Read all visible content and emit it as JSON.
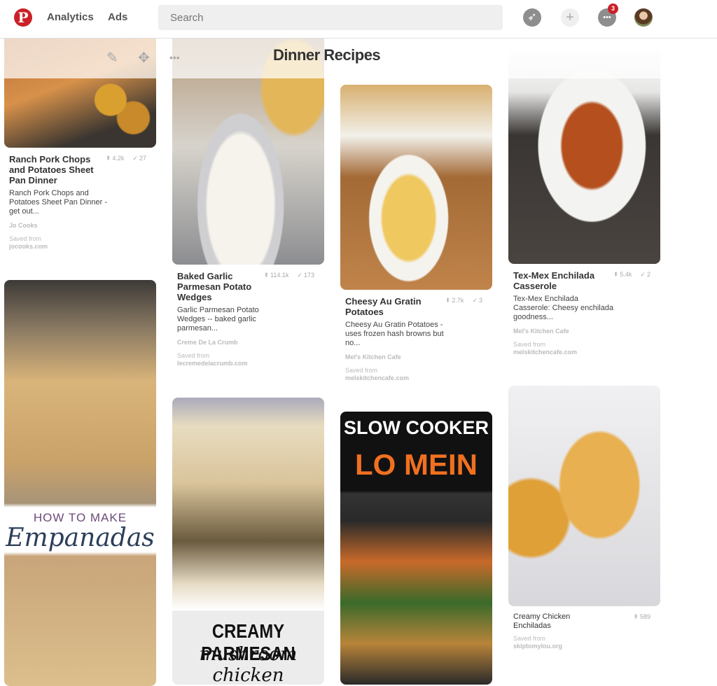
{
  "header": {
    "logo": "P",
    "nav": [
      "Analytics",
      "Ads"
    ],
    "search_placeholder": "Search",
    "notification_count": "3",
    "icons": [
      "compass-icon",
      "plus-icon",
      "chat-icon",
      "avatar"
    ]
  },
  "board": {
    "title": "Dinner Recipes",
    "tools": [
      "pencil-icon",
      "move-icon",
      "more-icon"
    ]
  },
  "colors": {
    "brand": "#cb2027"
  },
  "pins": [
    {
      "title": "Ranch Pork Chops and Potatoes Sheet Pan Dinner",
      "repins": "4.2k",
      "likes": "27",
      "description": "Ranch Pork Chops and Potatoes Sheet Pan Dinner - get out...",
      "author": "Jo Cooks",
      "saved_from": "Saved from",
      "domain": "jocooks.com"
    },
    {
      "title": "Baked Garlic Parmesan Potato Wedges",
      "repins": "114.1k",
      "likes": "173",
      "description": "Garlic Parmesan Potato Wedges -- baked garlic parmesan...",
      "author": "Creme De La Crumb",
      "saved_from": "Saved from",
      "domain": "lecremedelacrumb.com"
    },
    {
      "title": "Cheesy Au Gratin Potatoes",
      "repins": "2.7k",
      "likes": "3",
      "description": "Cheesy Au Gratin Potatoes - uses frozen hash browns but no...",
      "author": "Mel's Kitchen Cafe",
      "saved_from": "Saved from",
      "domain": "melskitchencafe.com"
    },
    {
      "title": "Tex-Mex Enchilada Casserole",
      "repins": "5.4k",
      "likes": "2",
      "description": "Tex-Mex Enchilada Casserole: Cheesy enchilada goodness...",
      "author": "Mel's Kitchen Cafe",
      "saved_from": "Saved from",
      "domain": "melskitchencafe.com"
    },
    {
      "title": "Creamy Chicken Enchiladas",
      "repins": "589",
      "saved_from": "Saved from",
      "domain": "skiptomylou.org"
    }
  ],
  "image_text": {
    "empanadas_top": "HOW TO MAKE",
    "empanadas_script": "Empanadas",
    "lomein_top": "SLOW COOKER",
    "lomein_bottom": "LO MEIN",
    "chicken_top": "CREAMY PARMESAN",
    "chicken_bottom": "mushroom chicken"
  }
}
